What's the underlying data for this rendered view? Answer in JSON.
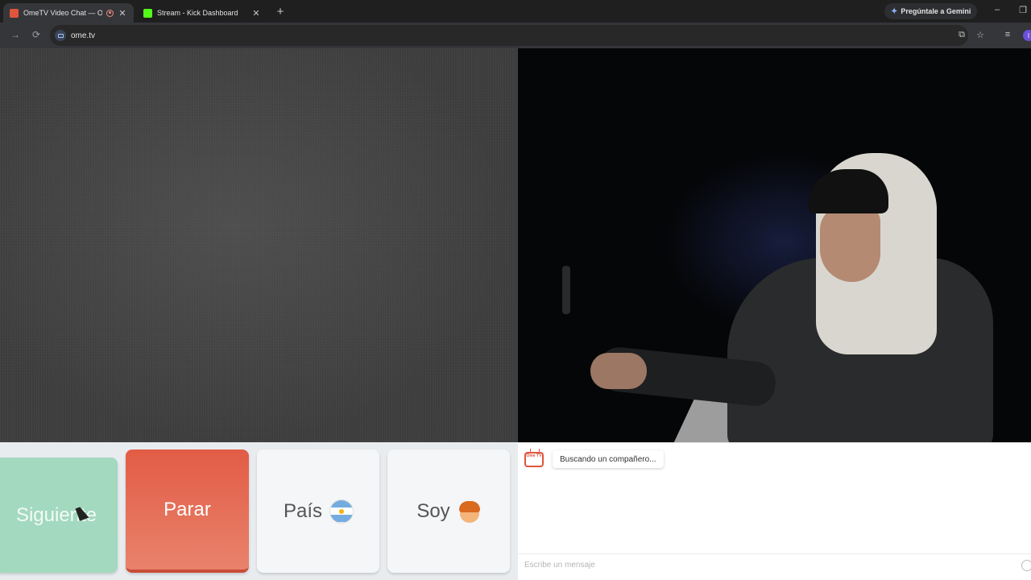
{
  "browser": {
    "tabs": [
      {
        "title": "OmeTV Video Chat — Ome",
        "active": true,
        "recording": true
      },
      {
        "title": "Stream - Kick Dashboard",
        "active": false
      }
    ],
    "new_tab_icon": "plus-icon",
    "gemini_label": "Pregúntale a Gemini",
    "url": "ome.tv",
    "profile_initial": "I"
  },
  "controls": {
    "next_label": "Siguiente",
    "stop_label": "Parar",
    "country_label": "País",
    "gender_label": "Soy"
  },
  "chat": {
    "logo_text": "Ome TV",
    "status_message": "Buscando un compañero...",
    "input_placeholder": "Escribe un mensaje"
  },
  "colors": {
    "next_button": "#a3d9bf",
    "stop_button": "#e25c45",
    "brand": "#e0543c"
  }
}
